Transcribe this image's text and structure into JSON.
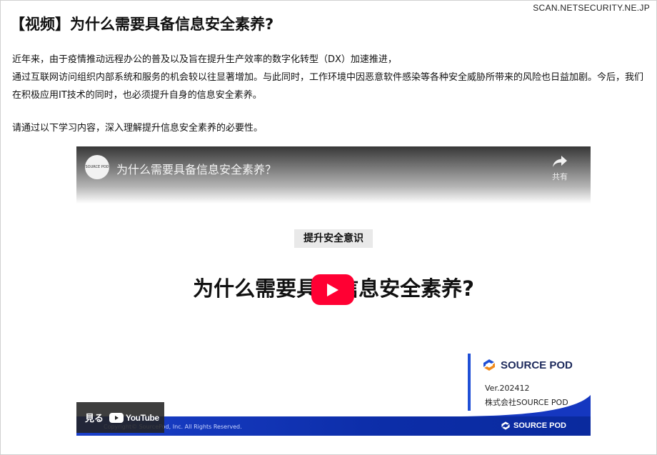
{
  "site": {
    "watermark": "SCAN.NETSECURITY.NE.JP"
  },
  "article": {
    "title": "【视频】为什么需要具备信息安全素养?",
    "intro_line1": "近年来，由于疫情推动远程办公的普及以及旨在提升生产效率的数字化转型（DX）加速推进，",
    "intro_line2": "通过互联网访问组织内部系统和服务的机会较以往显著增加。与此同时，工作环境中因恶意软件感染等各种安全威胁所带来的风险也日益加剧。今后，我们在积极应用IT技术的同时，也必须提升自身的信息安全素养。",
    "lead": "请通过以下学习内容，深入理解提升信息安全素养的必要性。"
  },
  "video": {
    "channel_avatar_text": "SOURCE POD",
    "title": "为什么需要具备信息安全素养？",
    "share_label": "共有",
    "slide_tag": "提升安全意识",
    "slide_heading": "为什么需要具备信息安全素养?",
    "brand_name": "SOURCE POD",
    "version": "Ver.202412",
    "company": "株式会社SOURCE POD",
    "copyright": "Copyright© SourcePod, Inc. All Rights Reserved.",
    "footer_brand": "SOURCE POD",
    "watch_on_label": "見る",
    "youtube_word": "YouTube",
    "colors": {
      "play_button": "#ff0033",
      "brand_blue": "#1f4fd6",
      "brand_accent": "#f08a1c"
    },
    "icons": {
      "play": "play-icon",
      "share": "share-arrow-icon",
      "youtube": "youtube-logo-icon",
      "brand": "source-pod-logo-icon"
    }
  }
}
